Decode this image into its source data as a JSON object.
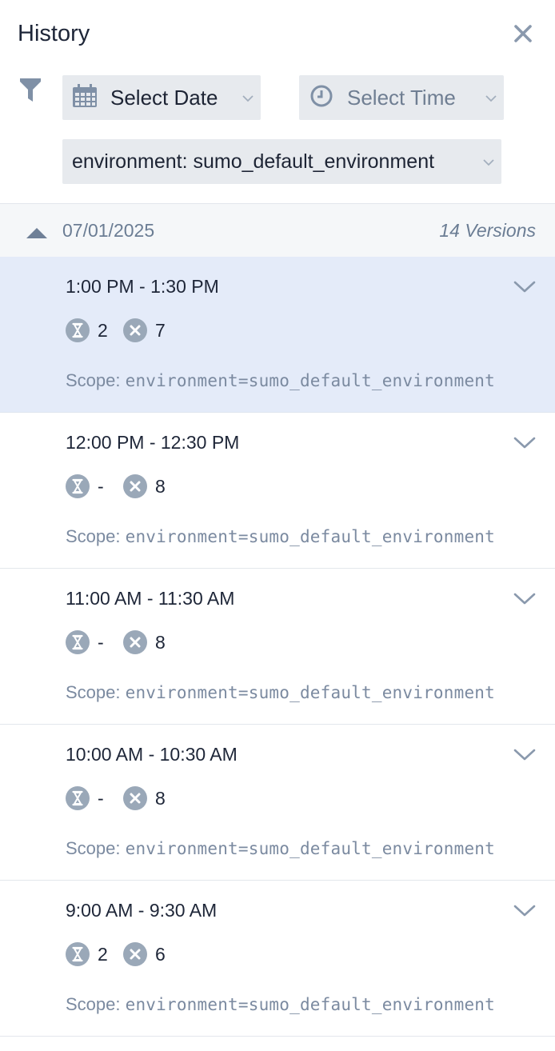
{
  "panel": {
    "title": "History",
    "close_icon": "close-icon",
    "filter_icon": "filter-icon"
  },
  "filters": {
    "date": {
      "label": "Select Date",
      "icon": "calendar-icon"
    },
    "time": {
      "label": "Select Time",
      "icon": "clock-icon"
    },
    "environment": {
      "label": "environment: sumo_default_environment"
    }
  },
  "group": {
    "date": "07/01/2025",
    "count": "14 Versions",
    "collapse_icon": "caret-up-icon"
  },
  "versions": [
    {
      "time": "1:00 PM - 1:30 PM",
      "pending": "2",
      "failed": "7",
      "scope_label": "Scope:",
      "scope_value": "environment=sumo_default_environment",
      "selected": true
    },
    {
      "time": "12:00 PM - 12:30 PM",
      "pending": "-",
      "failed": "8",
      "scope_label": "Scope:",
      "scope_value": "environment=sumo_default_environment",
      "selected": false
    },
    {
      "time": "11:00 AM - 11:30 AM",
      "pending": "-",
      "failed": "8",
      "scope_label": "Scope:",
      "scope_value": "environment=sumo_default_environment",
      "selected": false
    },
    {
      "time": "10:00 AM - 10:30 AM",
      "pending": "-",
      "failed": "8",
      "scope_label": "Scope:",
      "scope_value": "environment=sumo_default_environment",
      "selected": false
    },
    {
      "time": "9:00 AM - 9:30 AM",
      "pending": "2",
      "failed": "6",
      "scope_label": "Scope:",
      "scope_value": "environment=sumo_default_environment",
      "selected": false
    }
  ],
  "colors": {
    "selected_row": "#e4ebf9",
    "icon_gray": "#9aa8b8",
    "muted_text": "#7b8aa0"
  }
}
